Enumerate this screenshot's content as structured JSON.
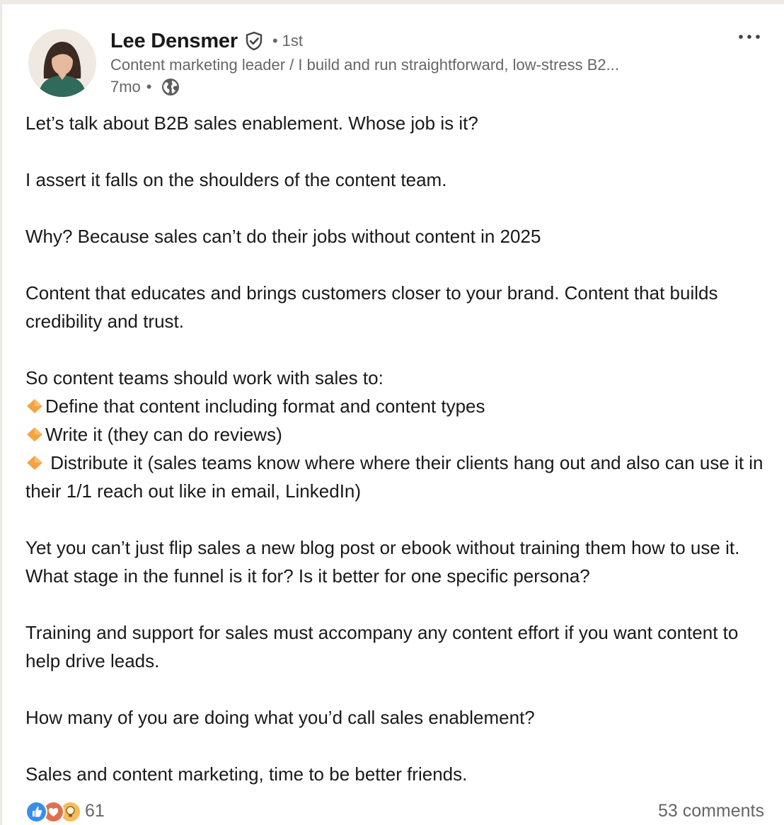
{
  "author": {
    "name": "Lee Densmer",
    "verified_icon": "verified-shield-icon",
    "degree_separator": "•",
    "degree": "1st",
    "headline": "Content marketing leader / I build and run straightforward, low-stress B2...",
    "age": "7mo",
    "meta_separator": "•",
    "visibility_icon": "globe-icon"
  },
  "menu": {
    "icon": "more-horizontal-icon"
  },
  "post": {
    "line_01": "Let’s talk about B2B sales enablement. Whose job is it?",
    "line_02": "I assert it falls on the shoulders of the content team.",
    "line_03": "Why? Because sales can’t do their jobs without content in 2025",
    "line_04": "Content that educates and brings customers closer to your brand. Content that builds credibility and trust.",
    "line_05": "So content teams should work with sales to:",
    "bullet_1": "Define that content including format and content types",
    "bullet_2": "Write it (they can do reviews)",
    "bullet_3": " Distribute it (sales teams know where where their clients hang out and also can use it in their 1/1 reach out like in email, LinkedIn)",
    "line_06": "Yet you can’t just flip sales a new blog post or ebook without training them how to use it. What stage in the funnel is it for? Is it better for one specific persona?",
    "line_07": "Training and support for sales must accompany any content effort if you want content to help drive leads.",
    "line_08": "How many of you are doing what you’d call sales enablement?",
    "line_09": "Sales and content marketing, time to be better friends.",
    "bullet_icon": "orange-diamond-icon"
  },
  "social": {
    "reaction_icons": [
      "like-icon",
      "love-icon",
      "insightful-icon"
    ],
    "reaction_count": "61",
    "comments": "53 comments"
  },
  "colors": {
    "text_primary": "#191919",
    "text_secondary": "#666666",
    "like_blue": "#378fe9",
    "love_red": "#df704d",
    "insightful_yellow": "#f5bb5c",
    "bullet_orange": "#f5a342"
  }
}
